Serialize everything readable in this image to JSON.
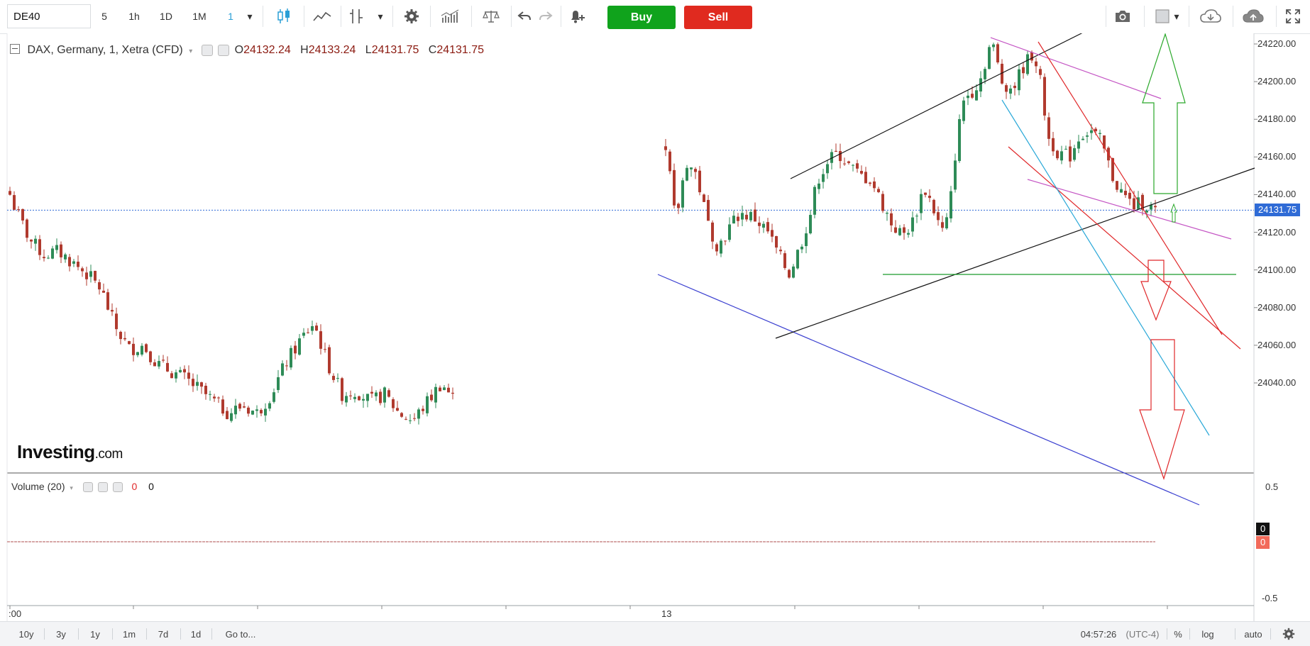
{
  "toolbar": {
    "symbol": "DE40",
    "intervals": [
      "5",
      "1h",
      "1D",
      "1M",
      "1"
    ],
    "active_interval": "1",
    "buy_label": "Buy",
    "sell_label": "Sell"
  },
  "legend": {
    "instrument": "DAX, Germany, 1, Xetra (CFD)",
    "o_label": "O",
    "o": "24132.24",
    "h_label": "H",
    "h": "24133.24",
    "l_label": "L",
    "l": "24131.75",
    "c_label": "C",
    "c": "24131.75"
  },
  "price_axis": {
    "ticks": [
      "24220.00",
      "24200.00",
      "24180.00",
      "24160.00",
      "24140.00",
      "24120.00",
      "24100.00",
      "24080.00",
      "24060.00",
      "24040.00"
    ],
    "current_price": "24131.75"
  },
  "volume": {
    "label": "Volume (20)",
    "value_red": "0",
    "value_black": "0",
    "axis_ticks": [
      "0.5",
      "-0.5"
    ],
    "tag_black": "0",
    "tag_red": "0"
  },
  "time_axis": {
    "left_label": ":00",
    "day_label": "13"
  },
  "logo": {
    "main": "Investing",
    "suffix": ".com"
  },
  "bottombar": {
    "ranges": [
      "10y",
      "3y",
      "1y",
      "1m",
      "7d",
      "1d"
    ],
    "goto": "Go to...",
    "time": "04:57:26",
    "timezone": "(UTC-4)",
    "percent": "%",
    "log": "log",
    "auto": "auto"
  },
  "colors": {
    "up": "#2e8b57",
    "down": "#b03a2e",
    "buy": "#10a31c",
    "sell": "#e02a1f",
    "price_tag": "#2f6bd6"
  }
}
